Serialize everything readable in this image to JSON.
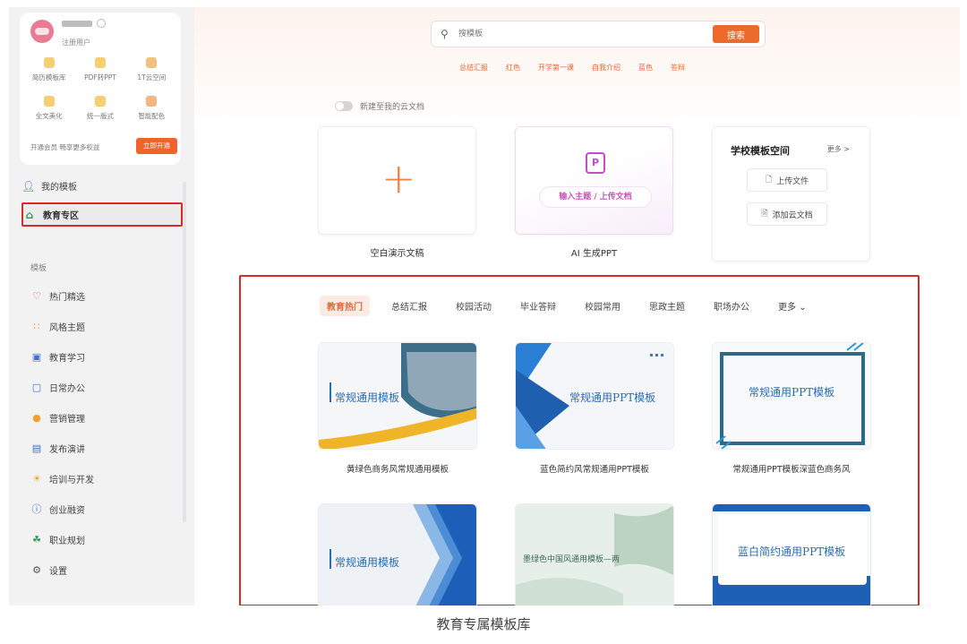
{
  "user": {
    "label": "注册用户"
  },
  "tools": [
    {
      "label": "简历模板库"
    },
    {
      "label": "PDF转PPT"
    },
    {
      "label": "1T云空间"
    },
    {
      "label": "全文美化"
    },
    {
      "label": "统一版式"
    },
    {
      "label": "智能配色"
    }
  ],
  "promo": {
    "text": "开通会员 畅享更多权益",
    "button": "立即开通"
  },
  "nav_top": [
    {
      "label": "我的模板",
      "icon": "user-icon"
    },
    {
      "label": "教育专区",
      "icon": "education-icon",
      "active": true
    }
  ],
  "section_label": "模板",
  "nav_templates": [
    {
      "label": "热门精选",
      "icon": "heart-icon"
    },
    {
      "label": "风格主题",
      "icon": "grid-icon"
    },
    {
      "label": "教育学习",
      "icon": "book-icon"
    },
    {
      "label": "日常办公",
      "icon": "monitor-icon"
    },
    {
      "label": "营销管理",
      "icon": "coin-icon"
    },
    {
      "label": "发布演讲",
      "icon": "chat-icon"
    },
    {
      "label": "培训与开发",
      "icon": "lightbulb-icon"
    },
    {
      "label": "创业融资",
      "icon": "info-icon"
    },
    {
      "label": "职业规划",
      "icon": "leaf-icon"
    },
    {
      "label": "设置",
      "icon": "gear-icon"
    }
  ],
  "search": {
    "placeholder": "搜模板",
    "button": "搜索"
  },
  "hot_keywords": [
    "总结汇报",
    "红色",
    "开学第一课",
    "自我介绍",
    "蓝色",
    "答辩"
  ],
  "cloud_toggle": {
    "label": "新建至我的云文档"
  },
  "cards": {
    "blank": {
      "label": "空白演示文稿"
    },
    "ai": {
      "button": "输入主题 / 上传文档",
      "label": "AI 生成PPT"
    },
    "school": {
      "title": "学校模板空间",
      "more": "更多 >",
      "upload": "上传文件",
      "add_cloud": "添加云文档"
    }
  },
  "tabs": [
    "教育热门",
    "总结汇报",
    "校园活动",
    "毕业答辩",
    "校园常用",
    "思政主题",
    "职场办公",
    "更多"
  ],
  "templates": [
    {
      "title": "常规通用模板",
      "caption": "黄绿色商务风常规通用模板"
    },
    {
      "title": "常规通用PPT模板",
      "caption": "蓝色简约风常规通用PPT模板"
    },
    {
      "title": "常规通用PPT模板",
      "caption": "常规通用PPT模板深蓝色商务风"
    },
    {
      "title": "常规通用模板",
      "caption": ""
    },
    {
      "title": "墨绿色中国风通用模板—两",
      "caption": ""
    },
    {
      "title": "蓝白简约通用PPT模板",
      "caption": ""
    }
  ],
  "caption": "教育专属模板库",
  "colors": {
    "accent": "#eb6a2c",
    "highlight_box": "#d42b2b",
    "template_blue": "#2b6cb0"
  }
}
